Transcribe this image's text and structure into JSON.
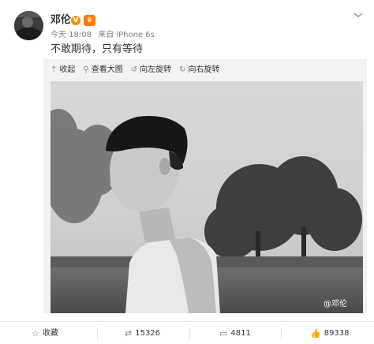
{
  "post": {
    "author": "邓伦",
    "verified_badge": "V",
    "member_badge": "♛",
    "time": "今天 18:08",
    "source": "来自 iPhone 6s",
    "text": "不敢期待，只有等待",
    "menu_icon": "chevron-down-icon"
  },
  "media_toolbar": {
    "collapse": "收起",
    "view_large": "查看大图",
    "rotate_left": "向左旋转",
    "rotate_right": "向右旋转"
  },
  "photo": {
    "watermark": "@邓伦"
  },
  "actions": {
    "favorite": "收藏",
    "repost_count": "15326",
    "comment_count": "4811",
    "like_count": "89338"
  }
}
